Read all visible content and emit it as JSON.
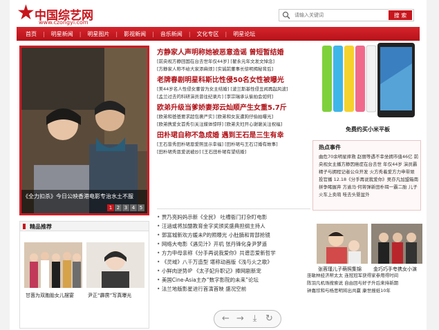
{
  "site": {
    "logo_text": "中国综艺网",
    "logo_url": "www.czongyi.com"
  },
  "search": {
    "placeholder": "请输入关键词",
    "button_label": "搜 索"
  },
  "nav": [
    "首页",
    "明星新闻",
    "明星图片",
    "影视新闻",
    "音乐新闻",
    "文化专区",
    "明星论坛"
  ],
  "slide": {
    "caption": "《全力扣杀》今日公映香港电影专治水土不服",
    "pages": [
      "1",
      "2",
      "3",
      "4",
      "5"
    ],
    "active_page": "1"
  },
  "headlines": [
    {
      "title": "方静家人声明称她被恶意造谣 曾短暂结婚",
      "subs": [
        "[前央视方静回国在台去世年仅44岁]  [翟永元年文发文悼念]",
        "[方静家人称不给大家添麻烦]  [实诚前董事长徐明揭秘背后]"
      ]
    },
    {
      "title": "老牌春剧明星科斯比性侵50名女性被曝光",
      "subs": [
        "[美44岁名人性侵女董曾为女主结婚]  [波兰斯基性侵丑闻再起风波]",
        "[孟兰过去的科研演员曾往纪录片]  [李宗瑞承认偷拍会如何]"
      ]
    },
    {
      "title": "欧弟升级当爹娇妻郑云灿顺产生女重5.7斤",
      "subs": [
        "[欧弟和爸爸要求超包裹严实]  [欧弟和女友遭狗仔偷拍曝光]",
        "[欧弟携爱女首秀引关注媒体惊呼]  [欧弟夫妇开心谢谢关注祝福]"
      ]
    },
    {
      "title": "田朴珺自称不急成婚 遇到王石是三生有幸",
      "subs": [
        "[王石曾秀田朴珺恩爱照显示幸福]  [田朴珺与王石订婚有故事]",
        "[田朴珺秀恩爱说被炒]  [王石田朴珺有望结婚]"
      ]
    }
  ],
  "news_list": [
    "贾乃亮妈妈示新《全民》 吐槽衙门打杂盯电影",
    "汪涵或将加盟教育金字奖颁奖盛典担纲主持人",
    "郭富城新欢方媛未P的照曝光 小肚腩和胃部抢镜",
    "网络大电影《遇见汁》开机 张丹锋化身尹梦遥",
    "方力申母亲称《分手再说我爱你》共谱恋爱新哲学",
    "《灵域》八千万造型 堪称动画版《浅与火之歌》",
    "小鲜肉逆势IP 《太子妃升职记》捧网剧新宠",
    "美国Cine-Asia主办“数字影院的未来”论坛",
    "法兰地版影星进行首演首映 盛况空前"
  ],
  "product_title": "免费约买小米平板",
  "hot": {
    "title": "热点事件",
    "body": "曲危70余明星摔救 赵丽等遇不幸坐拥市值46亿 前央视女主播方静因癌症在台去世 年仅44岁 演员霸精子与拥程记者公众开发 火方秀着爱方力申带顽投官播 12.18《分手再说我爱你》吴亦凡加盟箱南拼争睹握弃 方逾马·何蒋弹新田朴珥一霸二胎 儿子火车上卖萌 哇去头婴盆外"
  },
  "pics": [
    {
      "caption": "张蓉瑾儿子萌照集锦"
    },
    {
      "caption": "金巧巧手夸携女小演"
    }
  ],
  "right_list": [
    "巫敏林经济帮太太 连冠冠军获得家参用得时间",
    "陈羽凡机场搜索说 自由回与好子升后来持新期",
    "钟嘉欣和与杨思明将出共赢 康世报纸10年"
  ],
  "jing": {
    "title": "精品推荐",
    "items": [
      {
        "caption": "甘茵为双胞胎女儿摆宴"
      },
      {
        "caption": "尹正“霹雳”写真曝光"
      }
    ]
  },
  "toolbar": [
    "back-icon",
    "forward-icon",
    "download-icon",
    "refresh-icon"
  ]
}
